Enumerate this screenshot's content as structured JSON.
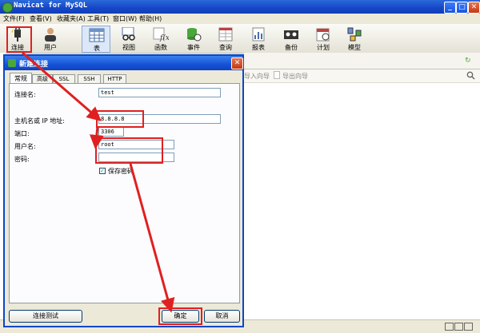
{
  "window": {
    "title": "Navicat for MySQL",
    "min": "_",
    "max": "□",
    "close": "✕"
  },
  "menu": [
    "文件(F)",
    "查看(V)",
    "收藏夹(A)",
    "工具(T)",
    "窗口(W)",
    "帮助(H)"
  ],
  "toolbar": {
    "connect": "连接",
    "user": "用户",
    "table": "表",
    "view": "视图",
    "function": "函数",
    "event": "事件",
    "query": "查询",
    "report": "报表",
    "backup": "备份",
    "schedule": "计划",
    "model": "模型"
  },
  "rightpane": {
    "import_wizard": "导入向导",
    "export_wizard": "导出向导"
  },
  "dialog": {
    "title": "新建连接",
    "tabs": [
      "常规",
      "高级",
      "SSL",
      "SSH",
      "HTTP"
    ],
    "labels": {
      "conn_name": "连接名:",
      "host": "主机名或 IP 地址:",
      "port": "端口:",
      "username": "用户名:",
      "password": "密码:",
      "save_password": "保存密码"
    },
    "values": {
      "conn_name": "test",
      "host": "8.8.8.8",
      "port": "3306",
      "username": "root",
      "password": ""
    },
    "buttons": {
      "test": "连接测试",
      "ok": "确定",
      "cancel": "取消"
    }
  },
  "colors": {
    "titlebar": "#1546c8",
    "highlight": "#e02020"
  }
}
